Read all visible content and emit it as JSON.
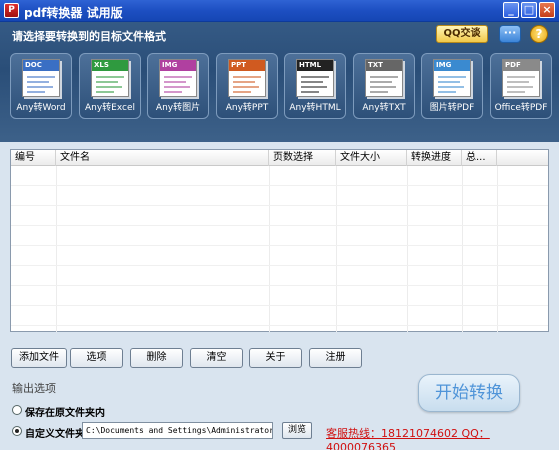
{
  "window": {
    "title": "pdf转换器 试用版",
    "icon_text": "P",
    "controls": [
      "_",
      "□",
      "×"
    ]
  },
  "header": {
    "prompt": "请选择要转换到的目标文件格式",
    "qq_button": "QQ交谈",
    "chat_icon": "···",
    "help_icon": "?"
  },
  "tools": [
    {
      "tag": "DOC",
      "label": "Any转Word",
      "color": "#3a6fc4",
      "icon": "word-doc-icon"
    },
    {
      "tag": "XLS",
      "label": "Any转Excel",
      "color": "#2f9a3f",
      "icon": "excel-chart-icon"
    },
    {
      "tag": "IMG",
      "label": "Any转图片",
      "color": "#b040a0",
      "icon": "image-icon"
    },
    {
      "tag": "PPT",
      "label": "Any转PPT",
      "color": "#d05a20",
      "icon": "ppt-slide-icon"
    },
    {
      "tag": "HTML",
      "label": "Any转HTML",
      "color": "#222222",
      "icon": "html-icon"
    },
    {
      "tag": "TXT",
      "label": "Any转TXT",
      "color": "#666666",
      "icon": "txt-icon"
    },
    {
      "tag": "IMG",
      "label": "图片转PDF",
      "color": "#3a8ad0",
      "icon": "image-to-pdf-icon"
    },
    {
      "tag": "PDF",
      "label": "Office转PDF",
      "color": "#8a8a8a",
      "icon": "pdf-icon"
    }
  ],
  "table": {
    "columns": [
      "编号",
      "文件名",
      "页数选择",
      "文件大小",
      "转换进度",
      "总..."
    ],
    "rows": []
  },
  "actions": {
    "add_file": "添加文件",
    "options": "选项",
    "delete": "删除",
    "clear": "清空",
    "about": "关于",
    "register": "注册"
  },
  "output": {
    "label": "输出选项",
    "save_original": "保存在原文件夹内",
    "custom_folder": "自定义文件夹",
    "path": "C:\\Documents and Settings\\Administrator\\桌面",
    "browse": "浏览",
    "hotline": "客服热线：18121074602 QQ：4000076365"
  },
  "start_button": "开始转换"
}
